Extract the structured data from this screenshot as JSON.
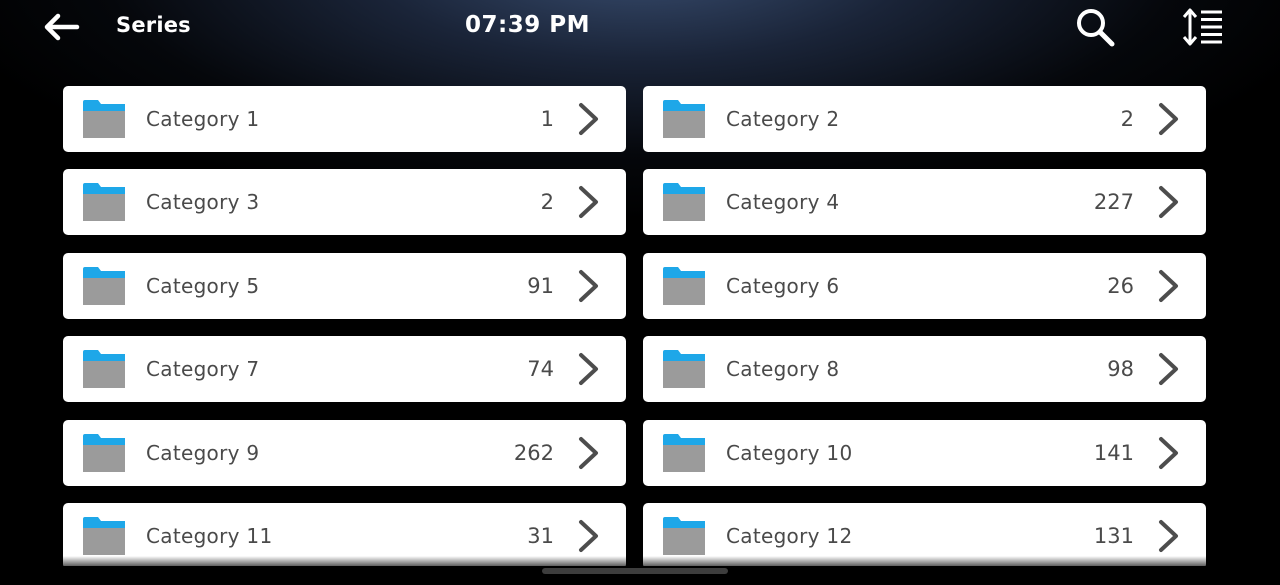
{
  "header": {
    "title": "Series",
    "time": "07:39 PM",
    "back_icon": "arrow-left-icon",
    "search_icon": "search-icon",
    "sort_icon": "sort-list-icon"
  },
  "colors": {
    "tile_background": "#ffffff",
    "text": "#4a4a4a",
    "folder_blue": "#1ea7e8",
    "folder_gray": "#9b9b9b"
  },
  "categories": [
    {
      "label": "Category 1",
      "count": "1"
    },
    {
      "label": "Category 2",
      "count": "2"
    },
    {
      "label": "Category 3",
      "count": "2"
    },
    {
      "label": "Category 4",
      "count": "227"
    },
    {
      "label": "Category 5",
      "count": "91"
    },
    {
      "label": "Category 6",
      "count": "26"
    },
    {
      "label": "Category 7",
      "count": "74"
    },
    {
      "label": "Category 8",
      "count": "98"
    },
    {
      "label": "Category 9",
      "count": "262"
    },
    {
      "label": "Category 10",
      "count": "141"
    },
    {
      "label": "Category 11",
      "count": "31"
    },
    {
      "label": "Category 12",
      "count": "131"
    }
  ]
}
